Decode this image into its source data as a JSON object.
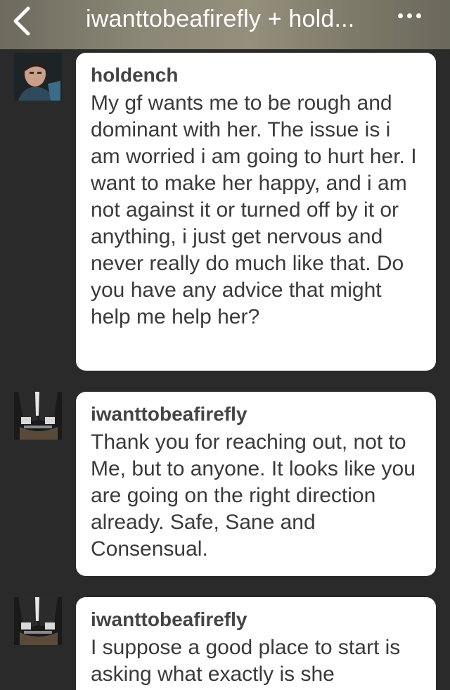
{
  "header": {
    "title": "iwanttobeafirefly + hold...",
    "back_icon": "chevron-left-icon",
    "more_icon": "more-dots-icon"
  },
  "messages": [
    {
      "sender": "holdench",
      "avatar_icon": "user-avatar",
      "text": "My gf wants me to be rough and dominant with her. The issue is i am worried i am going to hurt her. I want to make her happy, and i am not against it or turned off by it or anything, i just get nervous and never really do much like that. Do you have any advice that might help me help her?"
    },
    {
      "sender": "iwanttobeafirefly",
      "avatar_icon": "user-avatar",
      "text": "Thank you for reaching out, not to Me, but to anyone. It looks like you are going on the right direction already. Safe, Sane and Consensual."
    },
    {
      "sender": "iwanttobeafirefly",
      "avatar_icon": "user-avatar",
      "text": "I suppose a good place to start is asking what exactly is she"
    }
  ],
  "colors": {
    "background": "#2a2a2a",
    "bubble": "#ffffff",
    "sender_text": "#444444",
    "body_text": "#3a3a3a",
    "header_text": "#ffffff"
  }
}
